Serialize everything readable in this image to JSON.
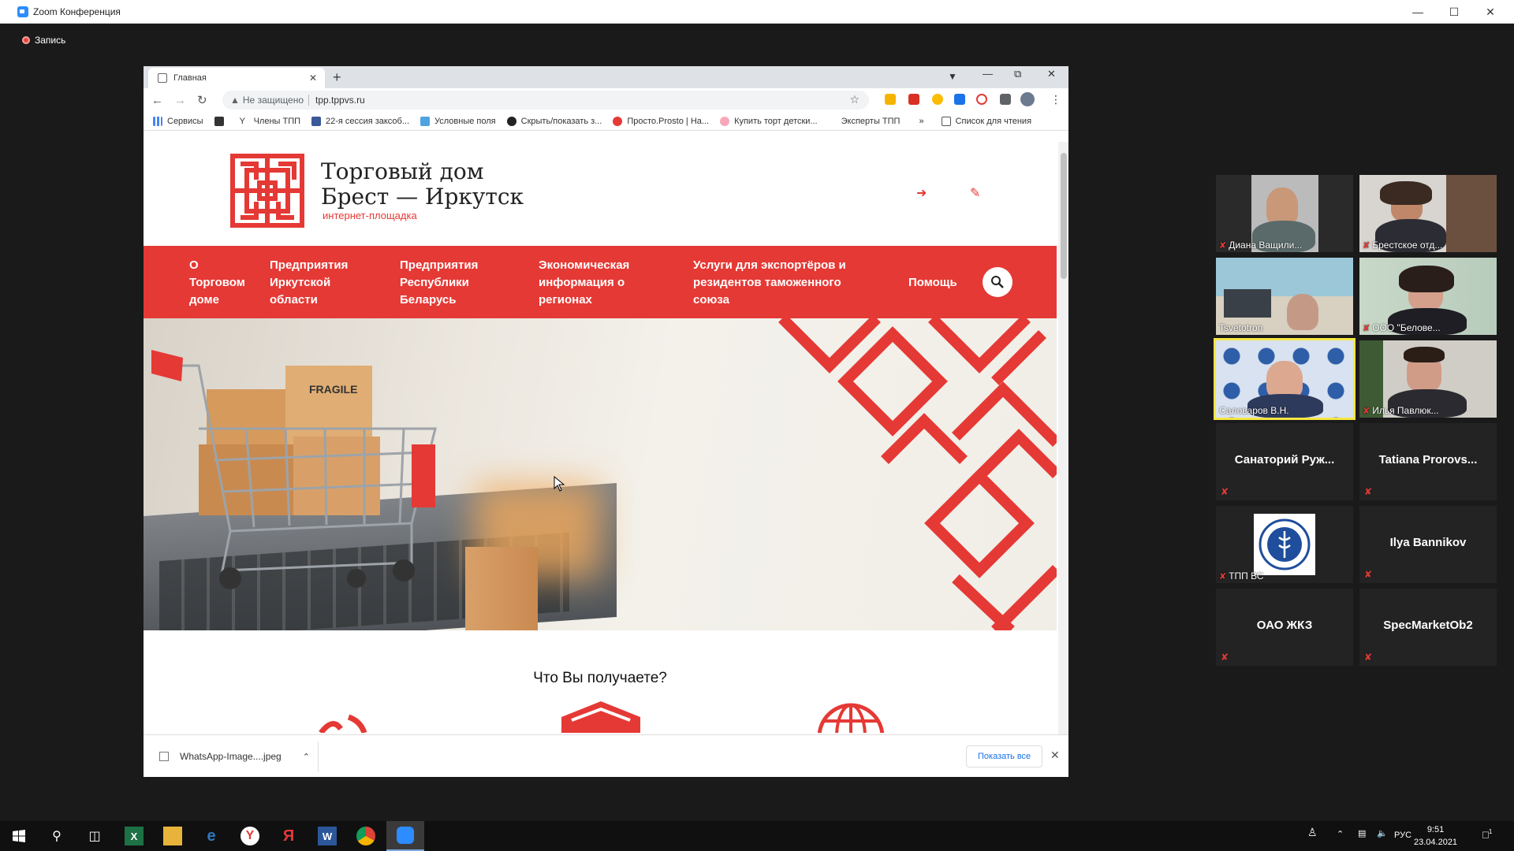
{
  "zoom": {
    "title": "Zoom Конференция",
    "record_label": "Запись"
  },
  "browser": {
    "tab_title": "Главная",
    "insecure_label": "Не защищено",
    "url": "tpp.tppvs.ru",
    "bookmarks": [
      "Сервисы",
      "Члены ТПП",
      "22-я сессия заксоб...",
      "Условные поля",
      "Скрыть/показать з...",
      "Просто.Prosto | На...",
      "Купить торт детски...",
      "Эксперты ТПП"
    ],
    "overflow_label": "»",
    "reading_list": "Список для чтения"
  },
  "site": {
    "logo_line1": "Торговый дом",
    "logo_line2": "Брест — Иркутск",
    "logo_sub": "интернет-площадка",
    "nav": [
      "О Торговом доме",
      "Предприятия Иркутской области",
      "Предприятия Республики Беларусь",
      "Экономическая информация о регионах",
      "Услуги для экспортёров и резидентов таможенного союза",
      "Помощь"
    ],
    "hero_box_text": "FRAGILE",
    "section_title": "Что Вы получаете?"
  },
  "downloads": {
    "file": "WhatsApp-Image....jpeg",
    "show_all": "Показать все"
  },
  "participants": [
    {
      "name": "Диана Ващили...",
      "muted": true,
      "video": true
    },
    {
      "name": "Брестское отд...",
      "muted": true,
      "video": true
    },
    {
      "name": "Tsvetotron",
      "muted": false,
      "video": true
    },
    {
      "name": "ООО \"Белове...",
      "muted": true,
      "video": true
    },
    {
      "name": "Саловаров В.Н.",
      "muted": false,
      "video": true,
      "active": true
    },
    {
      "name": "Илья Павлюк...",
      "muted": true,
      "video": true
    },
    {
      "name": "Санаторий Руж...",
      "muted": true,
      "video": false
    },
    {
      "name": "Tatiana Prorovs...",
      "muted": true,
      "video": false
    },
    {
      "name": "ТПП ВС",
      "muted": true,
      "video": true
    },
    {
      "name": "Ilya Bannikov",
      "muted": true,
      "video": false
    },
    {
      "name": "ОАО ЖКЗ",
      "muted": true,
      "video": false
    },
    {
      "name": "SpecMarketOb2",
      "muted": true,
      "video": false
    }
  ],
  "taskbar": {
    "language": "РУС",
    "time": "9:51",
    "date": "23.04.2021",
    "notification_count": "1"
  },
  "colors": {
    "brand_red": "#e53935",
    "zoom_blue": "#2d8cff",
    "active_speaker": "#f5e642"
  }
}
